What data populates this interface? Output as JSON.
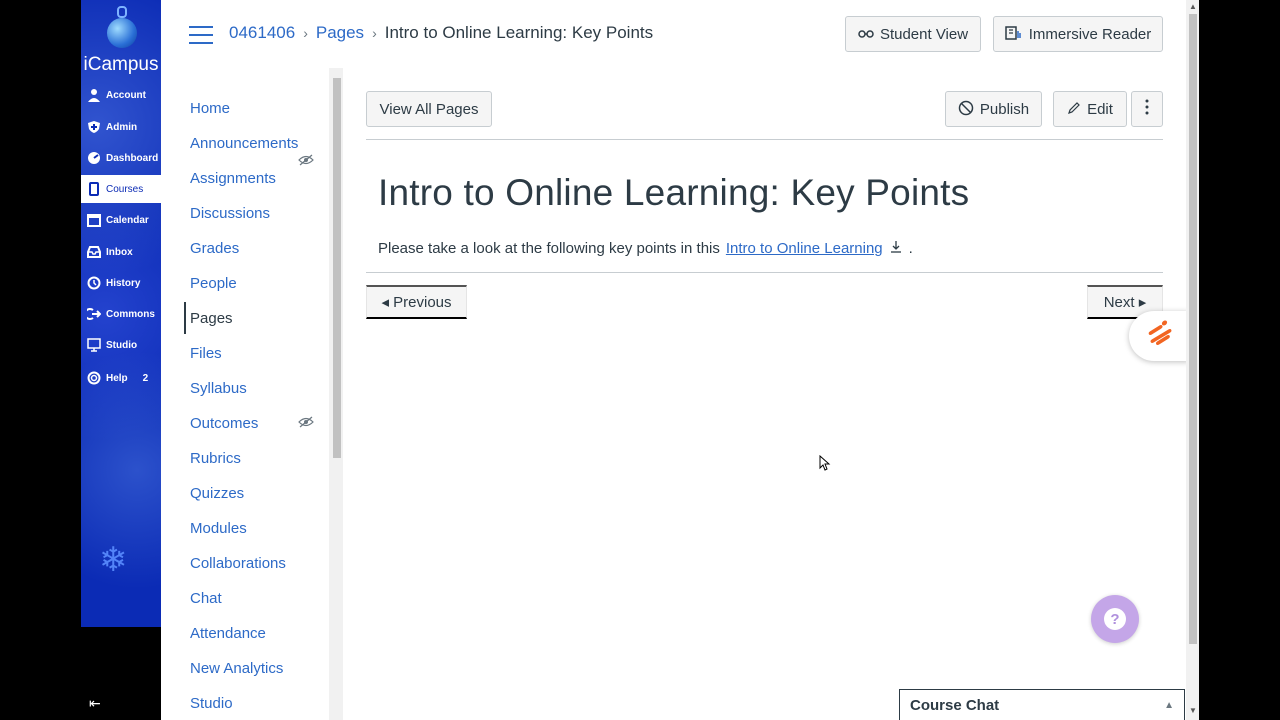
{
  "global_nav": {
    "logo": "iCampus",
    "items": [
      {
        "label": "Account",
        "icon": "user-icon"
      },
      {
        "label": "Admin",
        "icon": "shield-icon"
      },
      {
        "label": "Dashboard",
        "icon": "dashboard-icon"
      },
      {
        "label": "Courses",
        "icon": "book-icon"
      },
      {
        "label": "Calendar",
        "icon": "calendar-icon"
      },
      {
        "label": "Inbox",
        "icon": "inbox-icon"
      },
      {
        "label": "History",
        "icon": "clock-icon"
      },
      {
        "label": "Commons",
        "icon": "share-icon"
      },
      {
        "label": "Studio",
        "icon": "studio-icon"
      },
      {
        "label": "Help",
        "icon": "lifebuoy-icon"
      }
    ],
    "help_badge": "2"
  },
  "breadcrumb": {
    "course": "0461406",
    "section": "Pages",
    "current": "Intro to Online Learning: Key Points"
  },
  "header_buttons": {
    "student_view": "Student View",
    "immersive_reader": "Immersive Reader"
  },
  "course_nav": {
    "items": [
      "Home",
      "Announcements",
      "Assignments",
      "Discussions",
      "Grades",
      "People",
      "Pages",
      "Files",
      "Syllabus",
      "Outcomes",
      "Rubrics",
      "Quizzes",
      "Modules",
      "Collaborations",
      "Chat",
      "Attendance",
      "New Analytics",
      "Studio"
    ],
    "active": "Pages"
  },
  "toolbar": {
    "view_all_pages": "View All Pages",
    "publish": "Publish",
    "edit": "Edit"
  },
  "page": {
    "title": "Intro to Online Learning: Key Points",
    "text_before": "Please take a look at the following key points in this",
    "link_text": "Intro to Online Learning",
    "text_after": "."
  },
  "pager": {
    "previous": "◂ Previous",
    "next": "Next ▸"
  },
  "chat": {
    "label": "Course Chat"
  }
}
